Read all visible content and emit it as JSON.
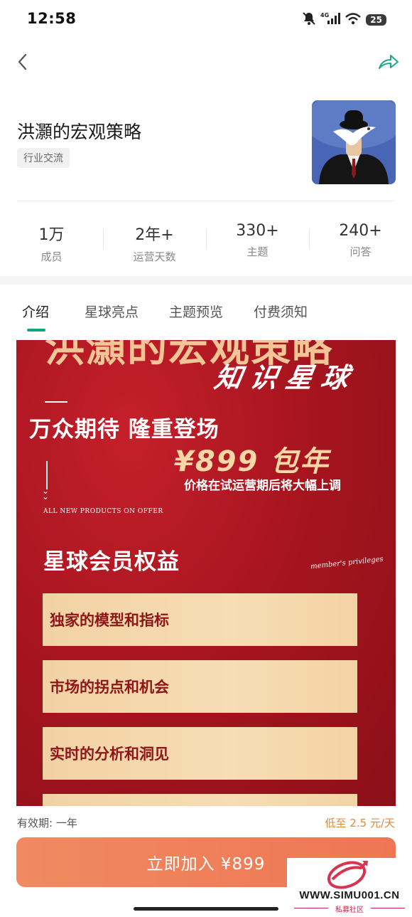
{
  "status_bar": {
    "time": "12:58",
    "network": "4G",
    "battery": "25",
    "icons": [
      "mute-bell-icon",
      "signal-icon",
      "wifi-icon",
      "battery-icon"
    ]
  },
  "nav": {
    "back_icon": "chevron-left-icon",
    "share_icon": "share-arrow-icon",
    "share_color": "#1ea886"
  },
  "group": {
    "title": "洪灝的宏观策略",
    "tag": "行业交流"
  },
  "stats": [
    {
      "value": "1万",
      "label": "成员"
    },
    {
      "value": "2年+",
      "label": "运营天数"
    },
    {
      "value": "330+",
      "label": "主题"
    },
    {
      "value": "240+",
      "label": "问答"
    }
  ],
  "tabs": [
    {
      "label": "介绍",
      "active": true
    },
    {
      "label": "星球亮点",
      "active": false
    },
    {
      "label": "主题预览",
      "active": false
    },
    {
      "label": "付费须知",
      "active": false
    }
  ],
  "poster": {
    "big_title": "洪灝的宏观策略",
    "script_title": "知识星球",
    "headline": "万众期待 隆重登场",
    "price": "¥899 包年",
    "price_note": "价格在试运营期后将大幅上调",
    "small_caption": "ALL NEW PRODUCTS ON OFFER",
    "section_title": "星球会员权益",
    "section_script": "member's privileges",
    "benefits": [
      "独家的模型和指标",
      "市场的拐点和机会",
      "实时的分析和洞见",
      ""
    ]
  },
  "bottom": {
    "validity": "有效期: 一年",
    "low_price": "低至 2.5 元/天",
    "join_button": "立即加入 ¥899",
    "accent": "#ee7654"
  },
  "watermark": {
    "site": "WWW.SIMU001.CN",
    "label": "私募社区"
  }
}
